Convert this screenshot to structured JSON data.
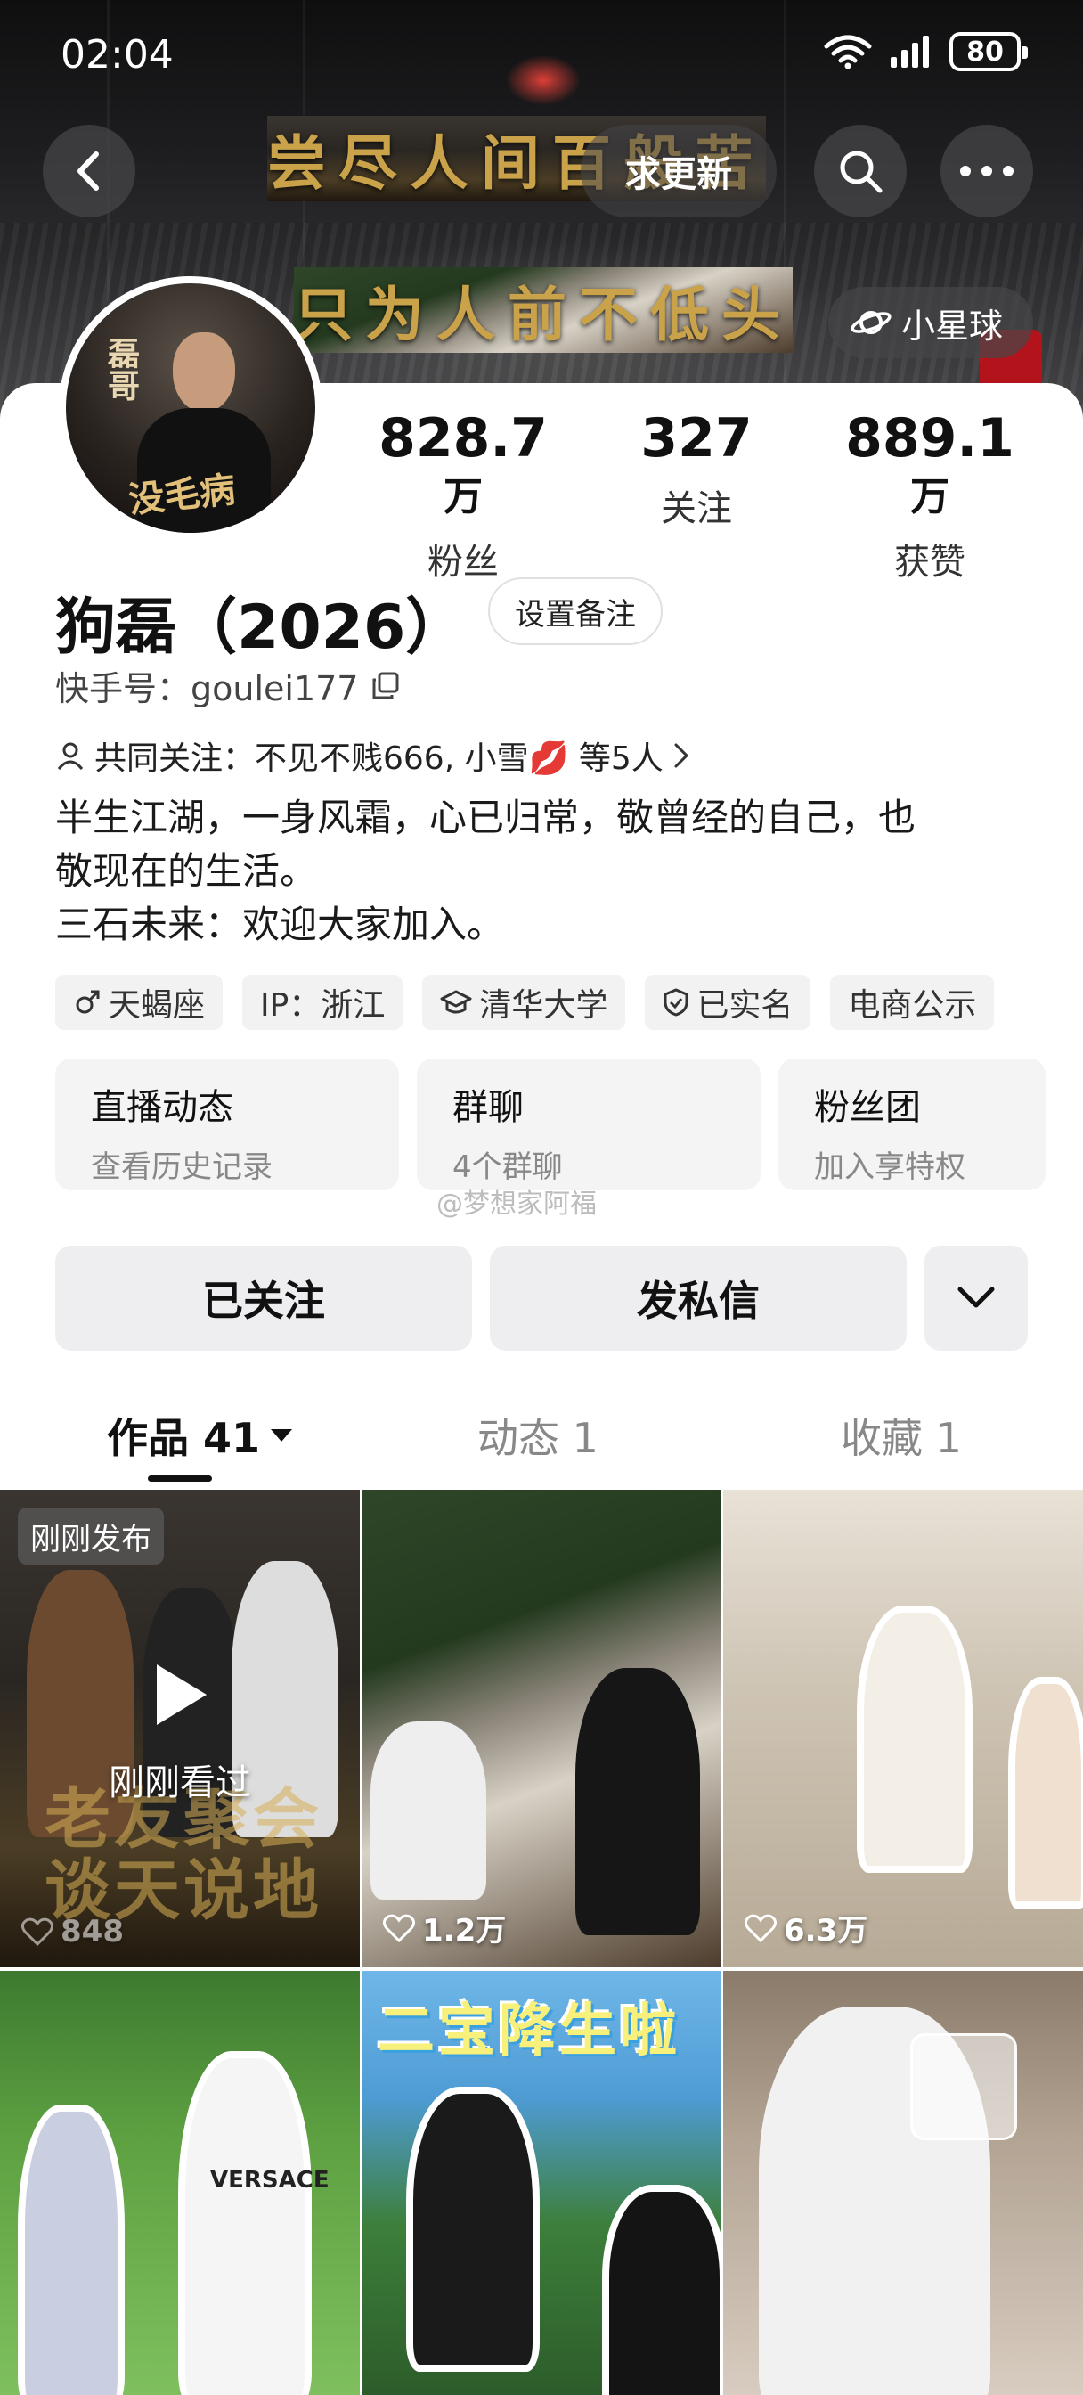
{
  "status_bar": {
    "time": "02:04",
    "battery": "80"
  },
  "header": {
    "banner_line1": "尝尽人间百般苦",
    "banner_line2": "只为人前不低头",
    "request_update": "求更新",
    "planet": "小星球"
  },
  "profile": {
    "avatar_name": "磊哥",
    "avatar_title": "没毛病",
    "stats": [
      {
        "num": "828.7",
        "unit": "万",
        "label": "粉丝"
      },
      {
        "num": "327",
        "unit": "",
        "label": "关注"
      },
      {
        "num": "889.1",
        "unit": "万",
        "label": "获赞"
      }
    ],
    "name": "狗磊（2026）",
    "remark_button": "设置备注",
    "kuaishou_id": "快手号：goulei177",
    "mutual_follow": "共同关注：不见不贱666, 小雪💋 等5人",
    "bio_line1": "半生江湖，一身风霜，心已归常，敬曾经的自己，也",
    "bio_line2": "敬现在的生活。",
    "bio_line3": "三石未来：欢迎大家加入。",
    "tags": [
      "天蝎座",
      "IP：浙江",
      "清华大学",
      "已实名",
      "电商公示"
    ]
  },
  "features": [
    {
      "title": "直播动态",
      "sub": "查看历史记录"
    },
    {
      "title": "群聊",
      "sub": "4个群聊"
    },
    {
      "title": "粉丝团",
      "sub": "加入享特权"
    }
  ],
  "watermark": "@梦想家阿福",
  "actions": {
    "followed": "已关注",
    "message": "发私信"
  },
  "tabs": [
    {
      "label": "作品 41"
    },
    {
      "label": "动态 1"
    },
    {
      "label": "收藏 1"
    }
  ],
  "videos": [
    {
      "badge": "刚刚发布",
      "viewed": "刚刚看过",
      "likes": "848",
      "title": "老友聚会 谈天说地"
    },
    {
      "likes": "1.2万"
    },
    {
      "likes": "6.3万"
    },
    {
      "caption": "VERSACE"
    },
    {
      "title": "二宝降生啦"
    },
    {}
  ],
  "colors": {
    "accent_gold": "#c9a24a",
    "tag_bg": "#f2f2f2",
    "button_bg": "#eeeef0"
  }
}
